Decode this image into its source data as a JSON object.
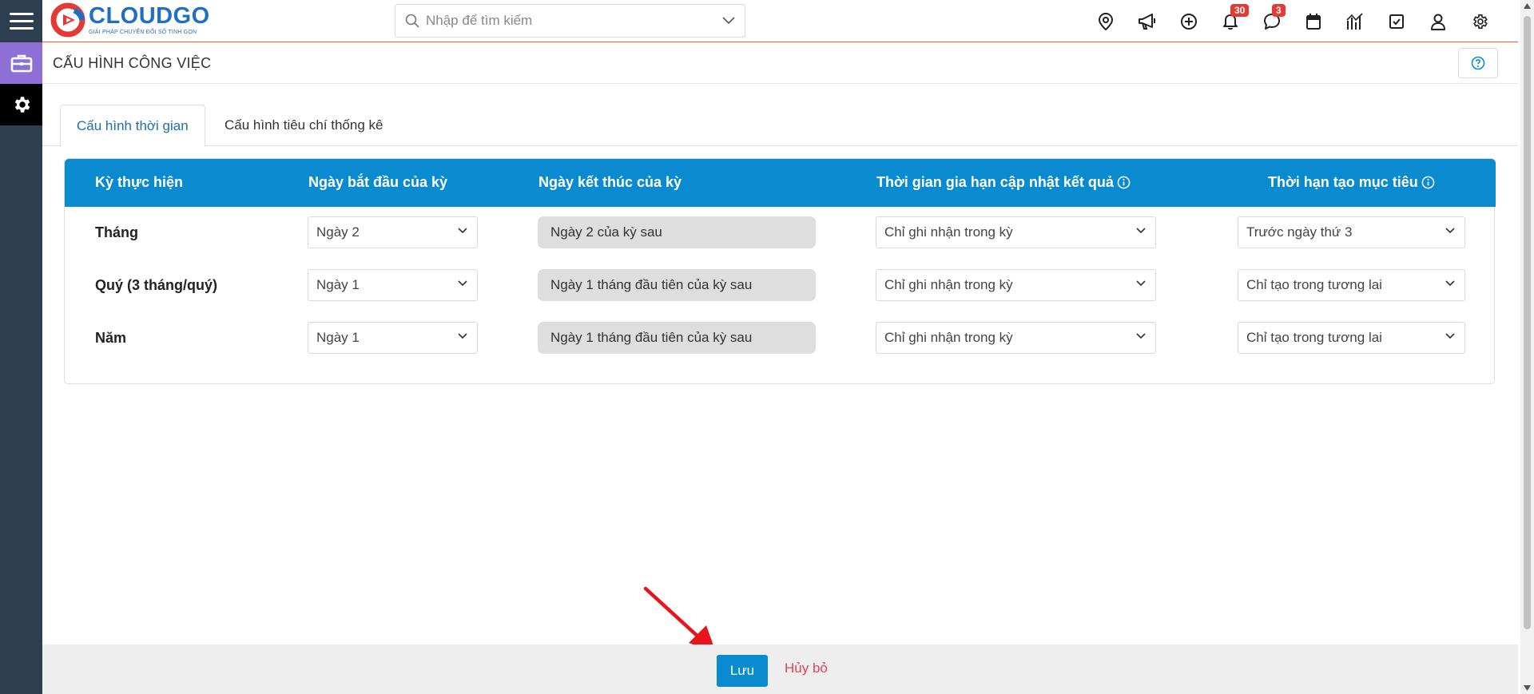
{
  "app": {
    "logo_name": "CLOUDGO",
    "logo_tagline": "GIẢI PHÁP CHUYỂN ĐỔI SỐ TINH GỌN",
    "brand_color": "#1f6fc7",
    "accent_color": "#0b8bcf"
  },
  "search": {
    "placeholder": "Nhập để tìm kiếm"
  },
  "header_icons": [
    {
      "icon": "map-pin-icon"
    },
    {
      "icon": "megaphone-icon"
    },
    {
      "icon": "plus-circle-icon"
    },
    {
      "icon": "bell-icon",
      "badge": "30"
    },
    {
      "icon": "chat-icon",
      "badge": "3"
    },
    {
      "icon": "calendar-icon"
    },
    {
      "icon": "chart-icon"
    },
    {
      "icon": "checkbox-icon"
    },
    {
      "icon": "user-icon"
    },
    {
      "icon": "settings-icon"
    }
  ],
  "page": {
    "title": "CẤU HÌNH CÔNG VIỆC"
  },
  "tabs": [
    {
      "label": "Cấu hình thời gian",
      "active": true
    },
    {
      "label": "Cấu hình tiêu chí thống kê",
      "active": false
    }
  ],
  "table": {
    "headers": {
      "period": "Kỳ thực hiện",
      "start": "Ngày bắt đầu của kỳ",
      "end": "Ngày kết thúc của kỳ",
      "grace": "Thời gian gia hạn cập nhật kết quả",
      "deadline": "Thời hạn tạo mục tiêu"
    },
    "rows": [
      {
        "period": "Tháng",
        "start": "Ngày 2",
        "end": "Ngày 2 của kỳ sau",
        "grace": "Chỉ ghi nhận trong kỳ",
        "deadline": "Trước ngày thứ 3"
      },
      {
        "period": "Quý (3 tháng/quý)",
        "start": "Ngày 1",
        "end": "Ngày 1 tháng đầu tiên của kỳ sau",
        "grace": "Chỉ ghi nhận trong kỳ",
        "deadline": "Chỉ tạo trong tương lai"
      },
      {
        "period": "Năm",
        "start": "Ngày 1",
        "end": "Ngày 1 tháng đầu tiên của kỳ sau",
        "grace": "Chỉ ghi nhận trong kỳ",
        "deadline": "Chỉ tạo trong tương lai"
      }
    ]
  },
  "footer": {
    "save_label": "Lưu",
    "cancel_label": "Hủy bỏ"
  }
}
